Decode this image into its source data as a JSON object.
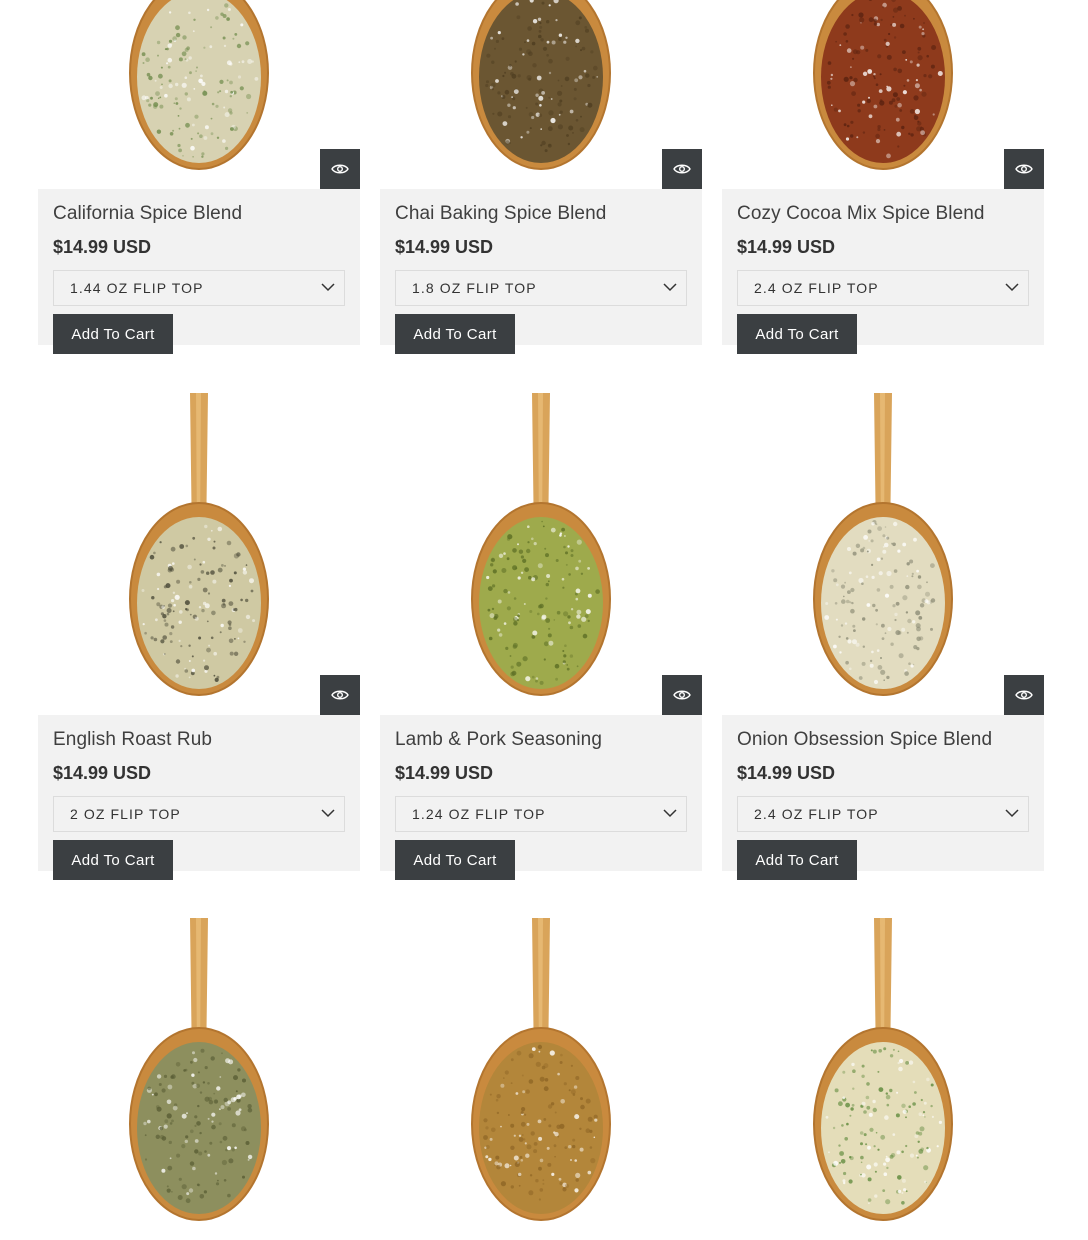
{
  "accent": "#3b3f42",
  "products": [
    {
      "title": "California Spice Blend",
      "price": "$14.99 USD",
      "variant": "1.44 oz Flip Top",
      "cart_label": "Add To Cart",
      "spice_color": "#d7d2b2",
      "speck_color": "#6e8a4a"
    },
    {
      "title": "Chai Baking Spice Blend",
      "price": "$14.99 USD",
      "variant": "1.8 oz Flip Top",
      "cart_label": "Add To Cart",
      "spice_color": "#6b5632",
      "speck_color": "#4e3d20"
    },
    {
      "title": "Cozy Cocoa Mix Spice Blend",
      "price": "$14.99 USD",
      "variant": "2.4 oz Flip Top",
      "cart_label": "Add To Cart",
      "spice_color": "#8e3a1c",
      "speck_color": "#5a2210"
    },
    {
      "title": "English Roast Rub",
      "price": "$14.99 USD",
      "variant": "2 oz Flip Top",
      "cart_label": "Add To Cart",
      "spice_color": "#cfc9a3",
      "speck_color": "#4b4a38"
    },
    {
      "title": "Lamb & Pork Seasoning",
      "price": "$14.99 USD",
      "variant": "1.24 oz Flip Top",
      "cart_label": "Add To Cart",
      "spice_color": "#9eaa4c",
      "speck_color": "#5c6e25"
    },
    {
      "title": "Onion Obsession Spice Blend",
      "price": "$14.99 USD",
      "variant": "2.4 oz Flip Top",
      "cart_label": "Add To Cart",
      "spice_color": "#e2dcc0",
      "speck_color": "#8a8a74"
    },
    {
      "title": "",
      "price": "",
      "variant": "",
      "cart_label": "",
      "spice_color": "#8d8f5e",
      "speck_color": "#5a5e35"
    },
    {
      "title": "",
      "price": "",
      "variant": "",
      "cart_label": "",
      "spice_color": "#b3863a",
      "speck_color": "#8f6626"
    },
    {
      "title": "",
      "price": "",
      "variant": "",
      "cart_label": "",
      "spice_color": "#e4ddb9",
      "speck_color": "#5f8a3c"
    }
  ]
}
